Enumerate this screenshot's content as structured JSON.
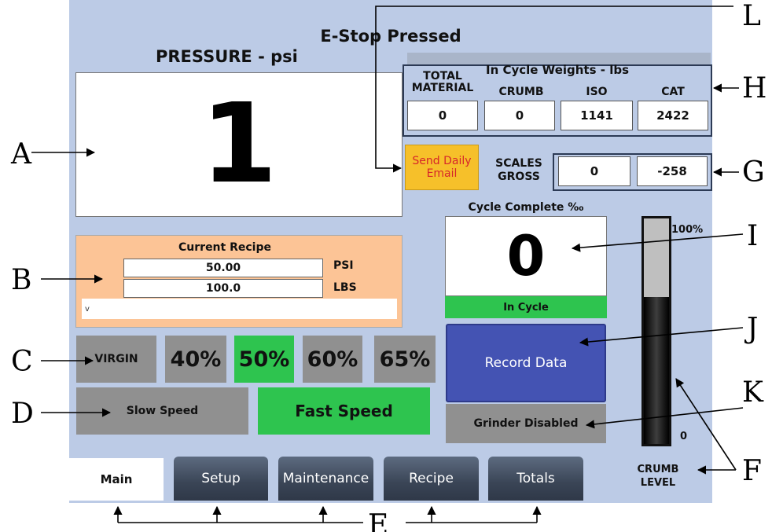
{
  "header": {
    "status": "E-Stop Pressed"
  },
  "pressure": {
    "title": "PRESSURE - psi",
    "value": "1"
  },
  "weights": {
    "title": "In Cycle Weights - lbs",
    "columns": [
      {
        "label": "TOTAL MATERIAL",
        "value": "0"
      },
      {
        "label": "CRUMB",
        "value": "0"
      },
      {
        "label": "ISO",
        "value": "1141"
      },
      {
        "label": "CAT",
        "value": "2422"
      }
    ]
  },
  "email_button": {
    "label": "Send Daily Email"
  },
  "scales": {
    "label": "SCALES GROSS",
    "values": [
      "0",
      "-258"
    ]
  },
  "cycle": {
    "label": "Cycle Complete ‰",
    "value": "0",
    "status": "In Cycle"
  },
  "record_button": {
    "label": "Record Data"
  },
  "grinder": {
    "label": "Grinder Disabled"
  },
  "crumb_level": {
    "max_label": "100%",
    "min_label": "0",
    "label": "CRUMB LEVEL",
    "fill_fraction": 0.65
  },
  "recipe": {
    "title": "Current Recipe",
    "psi_value": "50.00",
    "psi_unit": "PSI",
    "lbs_value": "100.0",
    "lbs_unit": "LBS",
    "selected": "v"
  },
  "mix_buttons": [
    {
      "label": "VIRGIN",
      "active": false
    },
    {
      "label": "40%",
      "active": false
    },
    {
      "label": "50%",
      "active": true
    },
    {
      "label": "60%",
      "active": false
    },
    {
      "label": "65%",
      "active": false
    }
  ],
  "speed_buttons": [
    {
      "label": "Slow Speed",
      "active": false
    },
    {
      "label": "Fast Speed",
      "active": true
    }
  ],
  "tabs": [
    {
      "label": "Main",
      "active": true
    },
    {
      "label": "Setup",
      "active": false
    },
    {
      "label": "Maintenance",
      "active": false
    },
    {
      "label": "Recipe",
      "active": false
    },
    {
      "label": "Totals",
      "active": false
    }
  ],
  "callouts": {
    "A": "A",
    "B": "B",
    "C": "C",
    "D": "D",
    "E": "E",
    "F": "F",
    "G": "G",
    "H": "H",
    "I": "I",
    "J": "J",
    "K": "K",
    "L": "L"
  },
  "colors": {
    "panel": "#bccbe6",
    "active_green": "#2ec44f",
    "inactive_gray": "#909090",
    "record_blue": "#4453b3",
    "email_yellow": "#f6c02a",
    "recipe_orange": "#fcc496"
  }
}
